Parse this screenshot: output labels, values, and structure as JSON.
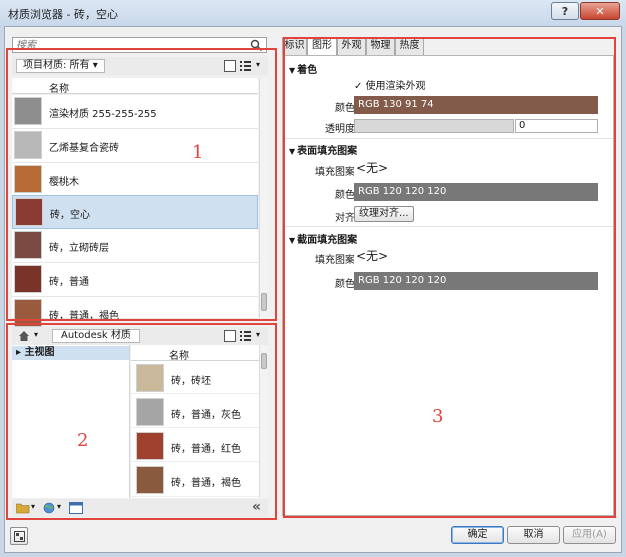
{
  "window": {
    "title": "材质浏览器 - 砖，空心",
    "help_label": "?",
    "close_label": "✕"
  },
  "search": {
    "placeholder": "搜索"
  },
  "project_materials": {
    "filter_label": "项目材质: 所有",
    "column_name": "名称",
    "items": [
      {
        "label": "渲染材质 255-255-255",
        "swatch": "#8e8e8e"
      },
      {
        "label": "乙烯基复合瓷砖",
        "swatch": "#b8b8b8"
      },
      {
        "label": "樱桃木",
        "swatch": "#b86a36"
      },
      {
        "label": "砖，空心",
        "swatch": "#8a3c32",
        "selected": true
      },
      {
        "label": "砖，立砌砖层",
        "swatch": "#7a4a42"
      },
      {
        "label": "砖，普通",
        "swatch": "#7a3328"
      },
      {
        "label": "砖，普通，褐色",
        "swatch": "#9a5a3e"
      }
    ]
  },
  "library": {
    "breadcrumb": "Autodesk 材质",
    "tree_root": "主视图",
    "column_name": "名称",
    "items": [
      {
        "label": "砖，砖坯",
        "swatch": "#c9b89a"
      },
      {
        "label": "砖，普通，灰色",
        "swatch": "#a5a5a5"
      },
      {
        "label": "砖，普通，红色",
        "swatch": "#a0402e"
      },
      {
        "label": "砖，普通，褐色",
        "swatch": "#8a5a3e"
      }
    ],
    "collapse_label": "«"
  },
  "annotations": {
    "one": "1",
    "two": "2",
    "three": "3"
  },
  "tabs": [
    "标识",
    "图形",
    "外观",
    "物理",
    "热度"
  ],
  "active_tab": "图形",
  "shading": {
    "title": "着色",
    "use_render_label": "使用渲染外观",
    "color_label": "颜色",
    "color_value": "RGB 130 91 74",
    "color_hex": "#825b4a",
    "transparency_label": "透明度",
    "transparency_value": "0"
  },
  "surface": {
    "title": "表面填充图案",
    "pattern_label": "填充图案",
    "pattern_value": "<无>",
    "color_label": "颜色",
    "color_value": "RGB 120 120 120",
    "color_hex": "#787878",
    "align_label": "对齐",
    "align_button": "纹理对齐..."
  },
  "cut": {
    "title": "截面填充图案",
    "pattern_label": "填充图案",
    "pattern_value": "<无>",
    "color_label": "颜色",
    "color_value": "RGB 120 120 120",
    "color_hex": "#787878"
  },
  "buttons": {
    "ok": "确定",
    "cancel": "取消",
    "apply": "应用(A)"
  }
}
